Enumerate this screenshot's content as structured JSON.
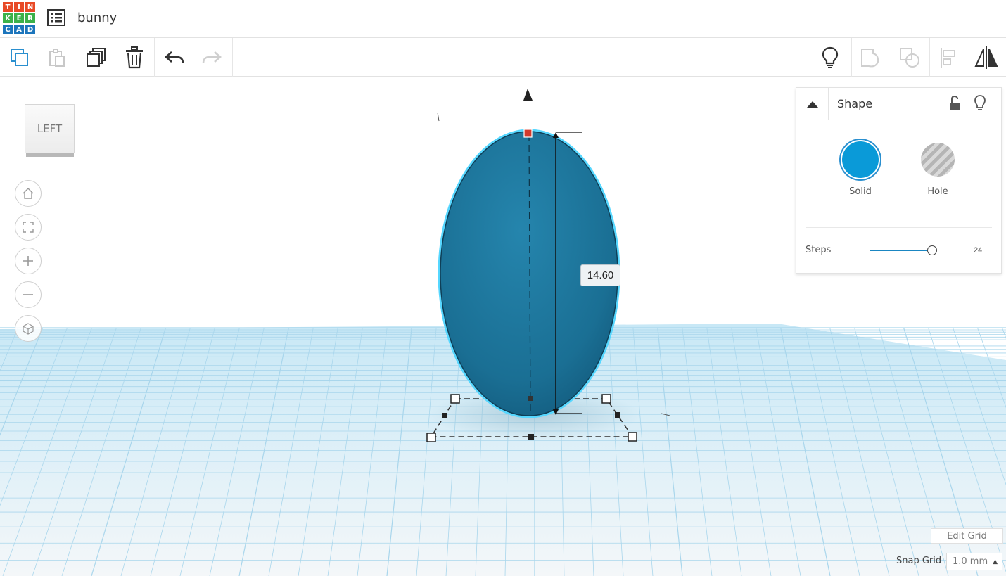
{
  "app": {
    "logo_letters": [
      "T",
      "I",
      "N",
      "K",
      "E",
      "R",
      "C",
      "A",
      "D"
    ],
    "logo_colors": [
      "#e84a27",
      "#e84a27",
      "#e84a27",
      "#3bb14a",
      "#3bb14a",
      "#3bb14a",
      "#1c75bc",
      "#1c75bc",
      "#1c75bc"
    ],
    "project_name": "bunny"
  },
  "toolbar": {
    "items": [
      "copy-icon",
      "paste-icon",
      "duplicate-icon",
      "delete-icon",
      "undo-icon",
      "redo-icon"
    ],
    "right_items": [
      "lightbulb-icon",
      "group-icon",
      "ungroup-icon",
      "align-icon",
      "mirror-icon"
    ]
  },
  "viewcube": {
    "face_label": "LEFT"
  },
  "nav": [
    "home-icon",
    "fit-view-icon",
    "zoom-in-icon",
    "zoom-out-icon",
    "perspective-icon"
  ],
  "dimension": {
    "value": "14.60"
  },
  "inspector": {
    "title": "Shape",
    "solid_label": "Solid",
    "hole_label": "Hole",
    "solid_color": "#0a9ad8",
    "steps_label": "Steps",
    "steps_value": "24",
    "steps_fraction": 0.92
  },
  "grid": {
    "edit_label": "Edit Grid",
    "snap_label": "Snap Grid",
    "snap_value": "1.0 mm"
  },
  "colors": {
    "shape_fill": "#1f7aa0",
    "shape_outline": "#4fd3ff",
    "grid_line": "#a9d6ec",
    "handle_red": "#d33a2c"
  }
}
